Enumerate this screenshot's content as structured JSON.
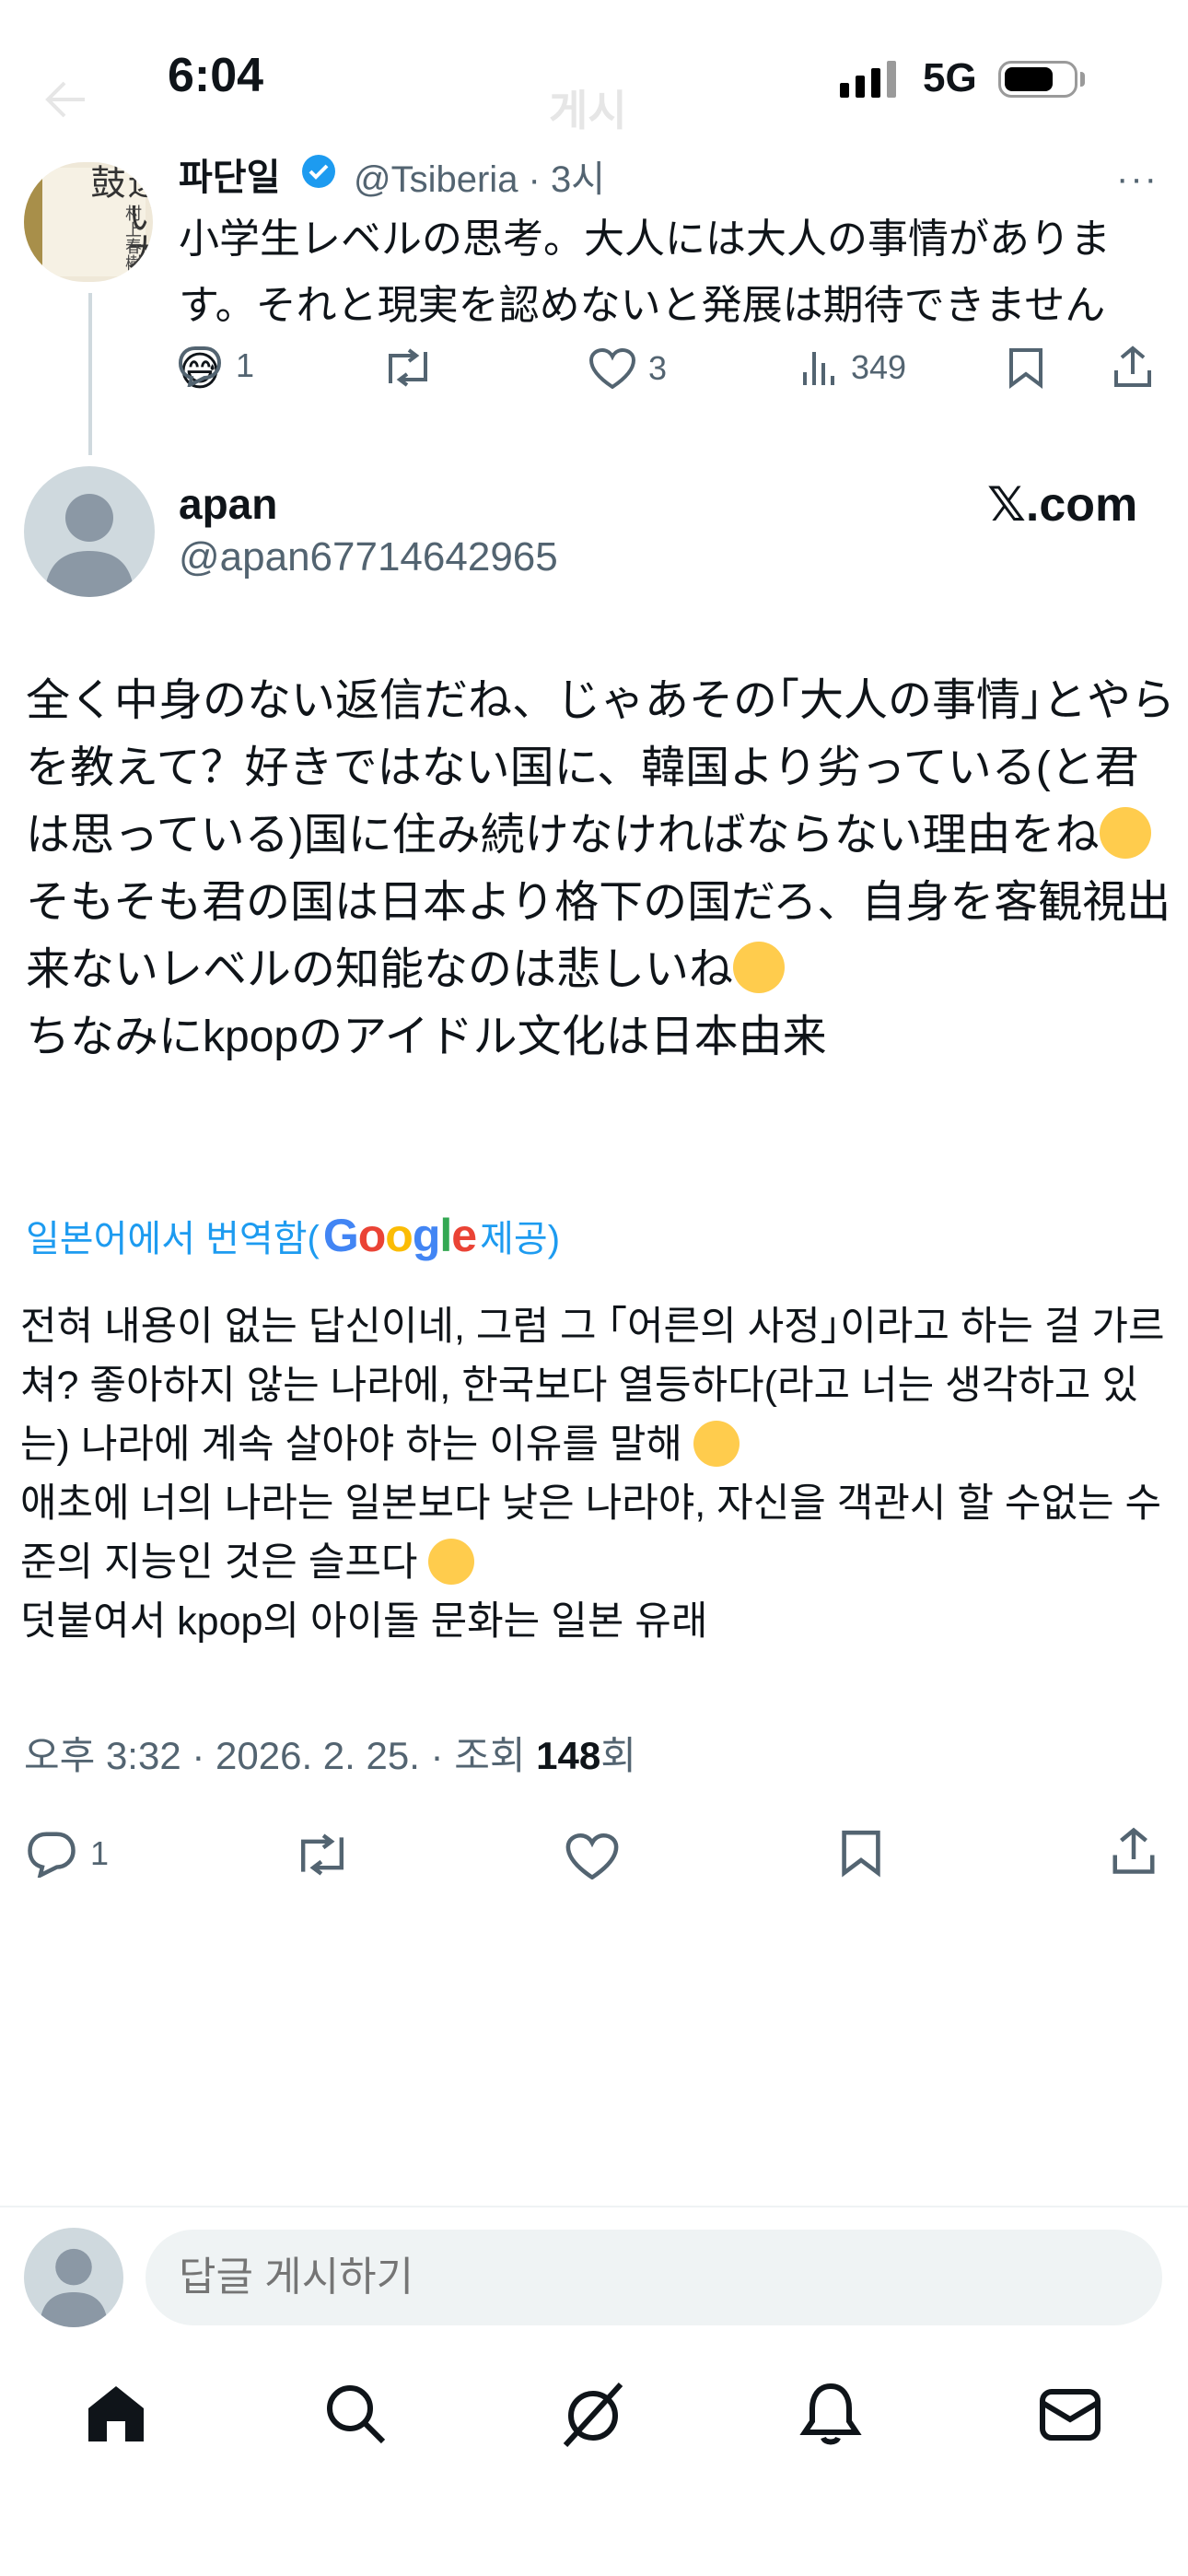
{
  "status_bar": {
    "time": "6:04",
    "network": "5G"
  },
  "header": {
    "title": "게시"
  },
  "parent_tweet": {
    "avatar_text": "遠い太鼓",
    "avatar_author": "村上春樹",
    "name": "파단일",
    "handle_time": "@Tsiberia · 3시",
    "text": "小学生レベルの思考。大人には大人の事情があります。それと現実を認めないと発展は期待できません😅",
    "replies": "1",
    "likes": "3",
    "views": "349"
  },
  "main_tweet": {
    "name": "apan",
    "handle": "@apan67714642965",
    "source": "𝕏.com",
    "text": "全く中身のない返信だね、じゃあその｢大人の事情｣とやらを教えて？好きではない国に、韓国より劣っている(と君は思っている)国に住み続けなければならない理由をね🤥\nそもそも君の国は日本より格下の国だろ、自身を客観視出来ないレベルの知能なのは悲しいね🤥\nちなみにkpopのアイドル文化は日本由来",
    "translate_prefix": "일본어에서 번역함(",
    "translate_brand": "Google",
    "translate_suffix": " 제공)",
    "translated_text": "전혀 내용이 없는 답신이네, 그럼 그 ｢어른의 사정｣이라고 하는 걸 가르쳐? 좋아하지 않는 나라에, 한국보다 열등하다(라고 너는 생각하고 있는) 나라에 계속 살아야 하는 이유를 말해 🤥\n애초에 너의 나라는 일본보다 낮은 나라야, 자신을 객관시 할 수없는 수준의 지능인 것은 슬프다 🤥\n덧붙여서 kpop의 아이돌 문화는 일본 유래",
    "meta_prefix": "오후 3:32 · 2026. 2. 25. · 조회 ",
    "views": "148",
    "meta_suffix": "회",
    "replies": "1"
  },
  "reply_bar": {
    "placeholder": "답글 게시하기"
  },
  "bottom_nav": [
    "home-icon",
    "search-icon",
    "grok-icon",
    "notifications-icon",
    "messages-icon"
  ],
  "colors": {
    "accent": "#1d9bf0",
    "muted": "#536471",
    "text": "#0f1419"
  }
}
